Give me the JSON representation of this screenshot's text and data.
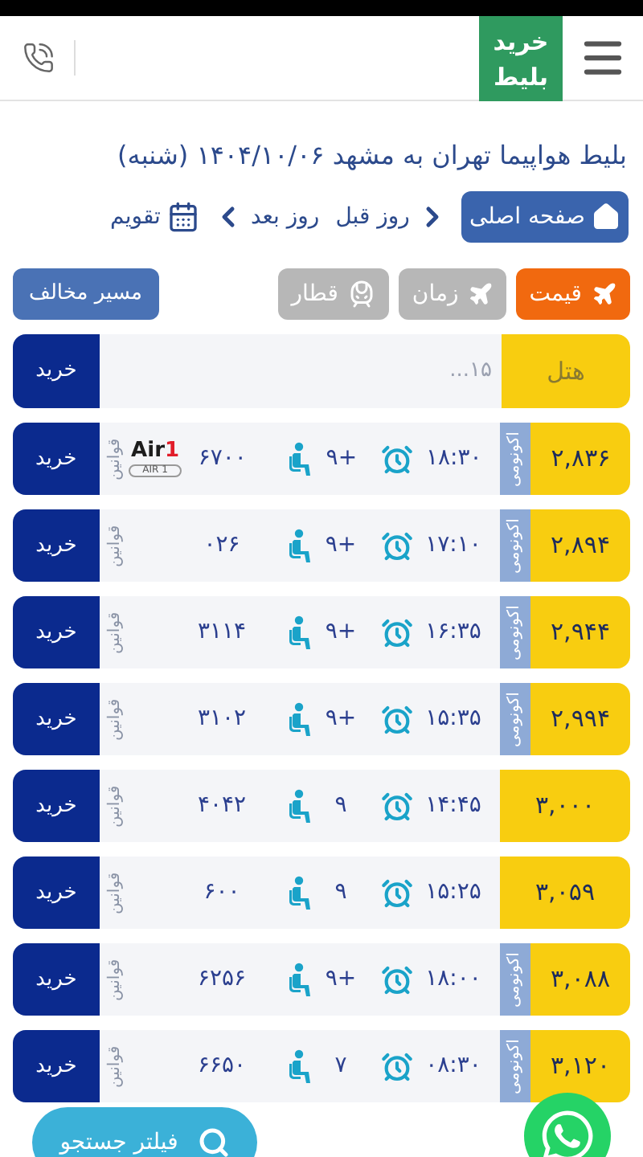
{
  "header": {
    "logo": [
      "خرید",
      "بلیط"
    ]
  },
  "title": "بلیط هواپیما تهران به مشهد ۱۴۰۴/۱۰/۰۶ (شنبه)",
  "nav": {
    "home": "صفحه اصلی",
    "prev": "روز قبل",
    "next": "روز بعد",
    "calendar": "تقویم"
  },
  "sort_tabs": [
    {
      "label": "قیمت",
      "kind": "plane",
      "selected": true
    },
    {
      "label": "زمان",
      "kind": "plane",
      "selected": false
    },
    {
      "label": "قطار",
      "kind": "train",
      "selected": false
    }
  ],
  "reverse_button": "مسیر مخالف",
  "hotel_row": {
    "label": "هتل",
    "text": "۱۵...",
    "buy": "خرید"
  },
  "flights": [
    {
      "price": "۲,۸۳۶",
      "cabin": "اکونومی",
      "time": "۱۸:۳۰",
      "seats": "+۹",
      "flight": "۶۷۰۰",
      "airline": {
        "name": "Air1",
        "code": "AIR 1"
      },
      "rules": "قوانین",
      "buy": "خرید"
    },
    {
      "price": "۲,۸۹۴",
      "cabin": "اکونومی",
      "time": "۱۷:۱۰",
      "seats": "+۹",
      "flight": "۰۲۶",
      "rules": "قوانین",
      "buy": "خرید"
    },
    {
      "price": "۲,۹۴۴",
      "cabin": "اکونومی",
      "time": "۱۶:۳۵",
      "seats": "+۹",
      "flight": "۳۱۱۴",
      "rules": "قوانین",
      "buy": "خرید"
    },
    {
      "price": "۲,۹۹۴",
      "cabin": "اکونومی",
      "time": "۱۵:۳۵",
      "seats": "+۹",
      "flight": "۳۱۰۲",
      "rules": "قوانین",
      "buy": "خرید"
    },
    {
      "price": "۳,۰۰۰",
      "time": "۱۴:۴۵",
      "seats": "۹",
      "flight": "۴۰۴۲",
      "rules": "قوانین",
      "buy": "خرید"
    },
    {
      "price": "۳,۰۵۹",
      "time": "۱۵:۲۵",
      "seats": "۹",
      "flight": "۶۰۰",
      "rules": "قوانین",
      "buy": "خرید"
    },
    {
      "price": "۳,۰۸۸",
      "cabin": "اکونومی",
      "time": "۱۸:۰۰",
      "seats": "+۹",
      "flight": "۶۲۵۶",
      "rules": "قوانین",
      "buy": "خرید"
    },
    {
      "price": "۳,۱۲۰",
      "cabin": "اکونومی",
      "time": "۰۸:۳۰",
      "seats": "۷",
      "flight": "۶۶۵۰",
      "rules": "قوانین",
      "buy": "خرید"
    }
  ],
  "filter_button": "فیلتر جستجو"
}
